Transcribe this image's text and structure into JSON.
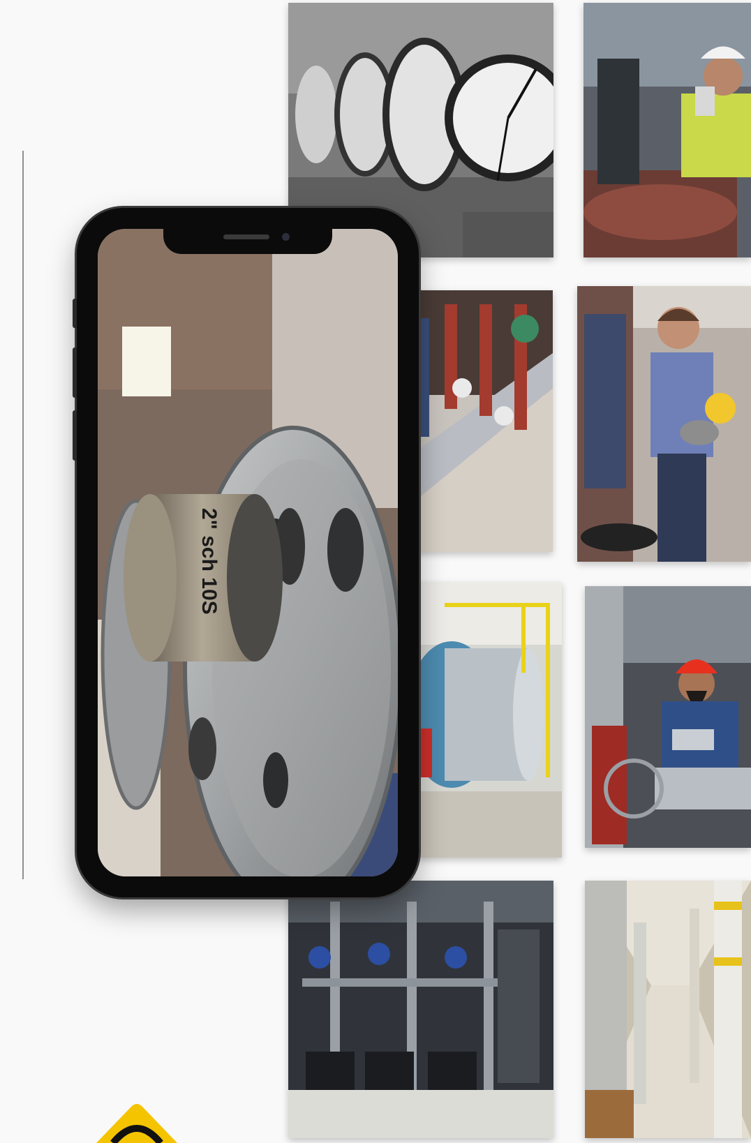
{
  "page": {
    "background": "#f9f9f9"
  },
  "phone": {
    "frame_color": "#0b0b0b",
    "screen_label": "2\" sch 10S"
  },
  "gallery": {
    "tiles": [
      {
        "name": "pressure-gauges-photo"
      },
      {
        "name": "inspector-with-tablet-photo"
      },
      {
        "name": "pipe-valves-photo"
      },
      {
        "name": "technicians-inspecting-photo"
      },
      {
        "name": "boiler-room-photo"
      },
      {
        "name": "engineer-red-helmet-photo"
      },
      {
        "name": "pump-station-photo"
      },
      {
        "name": "pipe-corridor-photo"
      }
    ]
  },
  "logo": {
    "accent_color": "#f5c400"
  }
}
